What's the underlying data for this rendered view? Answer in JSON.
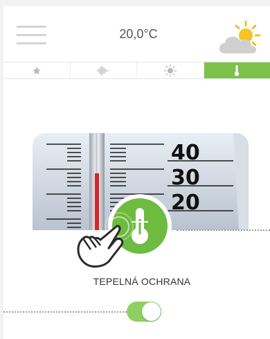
{
  "header": {
    "temperature": "20,0°C",
    "menu_icon": "hamburger-menu-icon",
    "weather_icon": "partly-cloudy-icon"
  },
  "tabs": [
    {
      "icon": "star-icon",
      "active": false
    },
    {
      "icon": "sound-wave-icon",
      "active": false
    },
    {
      "icon": "sun-icon",
      "active": false
    },
    {
      "icon": "thermometer-icon",
      "active": true
    }
  ],
  "hero": {
    "scale_labels": [
      "40",
      "30",
      "20"
    ]
  },
  "feature": {
    "label": "TEPELNÁ OCHRANA",
    "enabled": true
  },
  "colors": {
    "accent": "#7cc24a",
    "toggle_on": "#8fd063"
  }
}
